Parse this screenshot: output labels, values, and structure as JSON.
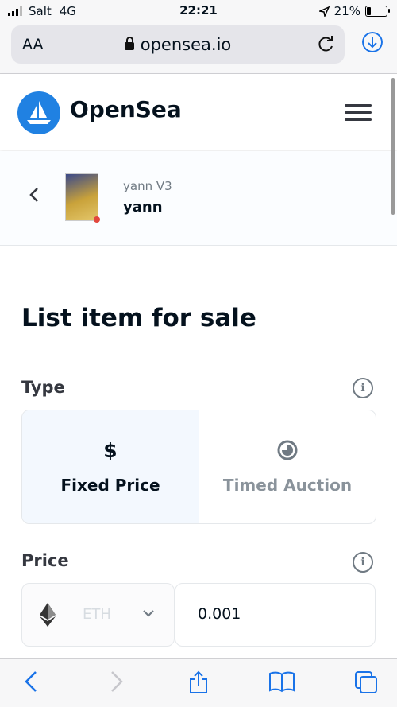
{
  "status_bar": {
    "carrier": "Salt",
    "network": "4G",
    "time": "22:21",
    "battery": "21%"
  },
  "browser": {
    "text_size_label": "AA",
    "url": "opensea.io"
  },
  "site": {
    "brand": "OpenSea",
    "brand_color": "#2081e2"
  },
  "item": {
    "collection": "yann V3",
    "name": "yann"
  },
  "form": {
    "title": "List item for sale",
    "type_label": "Type",
    "type_options": [
      {
        "label": "Fixed Price",
        "icon": "dollar-icon",
        "selected": true
      },
      {
        "label": "Timed Auction",
        "icon": "clock-icon",
        "selected": false
      }
    ],
    "price_label": "Price",
    "currency": "ETH",
    "amount": "0.001"
  },
  "icons": {
    "back": "chevron-left-icon",
    "menu": "hamburger-menu-icon",
    "info": "info-icon",
    "eth": "ethereum-icon",
    "dropdown": "chevron-down-icon"
  }
}
